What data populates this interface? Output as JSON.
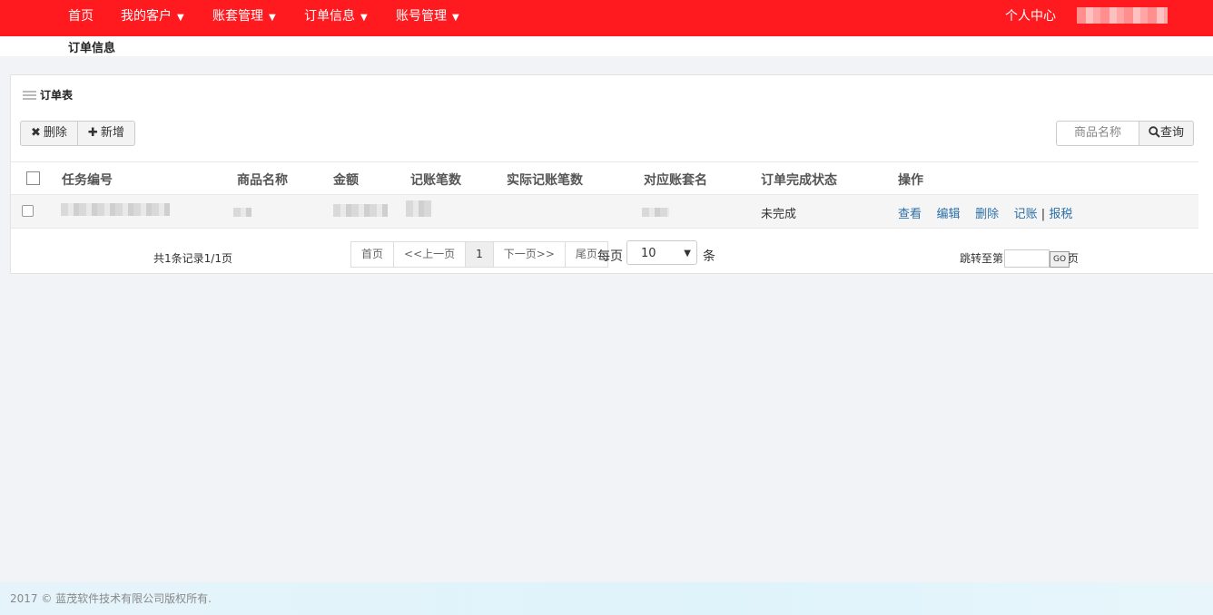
{
  "nav": {
    "items": [
      {
        "label": "首页",
        "has_dropdown": false
      },
      {
        "label": "我的客户",
        "has_dropdown": true
      },
      {
        "label": "账套管理",
        "has_dropdown": true
      },
      {
        "label": "订单信息",
        "has_dropdown": true
      },
      {
        "label": "账号管理",
        "has_dropdown": true
      }
    ],
    "user_center": "个人中心",
    "dropdown_glyph": "▼",
    "bar_color": "#ff1a1f"
  },
  "breadcrumb": "订单信息",
  "panel": {
    "title": "订单表",
    "toolbar": {
      "delete_label": "删除",
      "add_label": "新增",
      "delete_icon": "✖",
      "add_icon": "✚"
    },
    "search": {
      "placeholder": "商品名称",
      "button_label": "查询",
      "icon": "magnifier-icon"
    }
  },
  "table": {
    "columns": [
      "任务编号",
      "商品名称",
      "金额",
      "记账笔数",
      "实际记账笔数",
      "对应账套名",
      "订单完成状态",
      "操作"
    ],
    "rows": [
      {
        "status": "未完成",
        "actions": [
          "查看",
          "编辑",
          "删除",
          "记账",
          "报税"
        ]
      }
    ]
  },
  "pagination": {
    "info": "共1条记录1/1页",
    "first": "首页",
    "prev": "<<上一页",
    "current": "1",
    "next": "下一页>>",
    "last": "尾页",
    "per_page_label": "每页",
    "per_page_value": "10",
    "per_page_unit": "条",
    "jump_label": "跳转至第",
    "go_label": "GO",
    "page_unit": "页"
  },
  "footer": {
    "copyright": "2017 © 蓝茂软件技术有限公司版权所有."
  }
}
